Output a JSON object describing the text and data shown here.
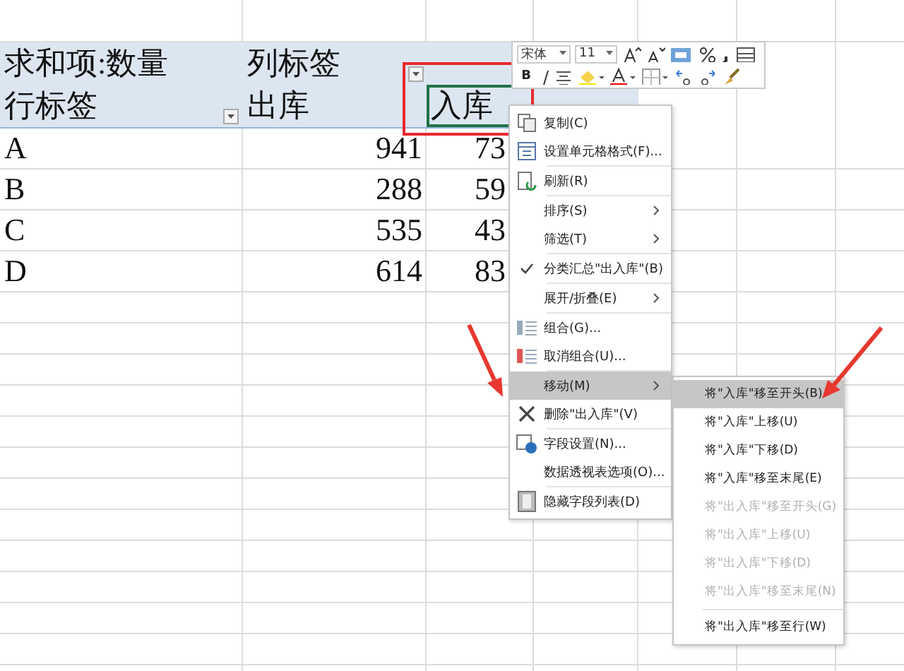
{
  "pivot": {
    "value_header": "求和项:数量",
    "column_header": "列标签",
    "row_header": "行标签",
    "columns": [
      {
        "label": "出库",
        "selected": false
      },
      {
        "label": "入库",
        "selected": true
      }
    ],
    "rows": [
      {
        "label": "A",
        "values": [
          "941",
          "73"
        ]
      },
      {
        "label": "B",
        "values": [
          "288",
          "59"
        ]
      },
      {
        "label": "C",
        "values": [
          "535",
          "43"
        ]
      },
      {
        "label": "D",
        "values": [
          "614",
          "83"
        ]
      }
    ]
  },
  "mini_toolbar": {
    "font": "宋体",
    "size": "11",
    "bold": "B"
  },
  "context_menu": [
    {
      "kind": "item",
      "label": "复制(C)",
      "submenu": false,
      "checked": false,
      "selected": false
    },
    {
      "kind": "item",
      "label": "设置单元格格式(F)...",
      "submenu": false,
      "checked": false,
      "selected": false
    },
    {
      "kind": "separator"
    },
    {
      "kind": "item",
      "label": "刷新(R)",
      "submenu": false,
      "checked": false,
      "selected": false
    },
    {
      "kind": "separator"
    },
    {
      "kind": "item",
      "label": "排序(S)",
      "submenu": true,
      "checked": false,
      "selected": false
    },
    {
      "kind": "item",
      "label": "筛选(T)",
      "submenu": true,
      "checked": false,
      "selected": false
    },
    {
      "kind": "separator"
    },
    {
      "kind": "item",
      "label": "分类汇总\"出入库\"(B)",
      "submenu": false,
      "checked": true,
      "selected": false
    },
    {
      "kind": "separator"
    },
    {
      "kind": "item",
      "label": "展开/折叠(E)",
      "submenu": true,
      "checked": false,
      "selected": false
    },
    {
      "kind": "separator"
    },
    {
      "kind": "item",
      "label": "组合(G)...",
      "submenu": false,
      "checked": false,
      "selected": false
    },
    {
      "kind": "item",
      "label": "取消组合(U)...",
      "submenu": false,
      "checked": false,
      "selected": false
    },
    {
      "kind": "separator"
    },
    {
      "kind": "item",
      "label": "移动(M)",
      "submenu": true,
      "checked": false,
      "selected": true
    },
    {
      "kind": "item",
      "label": "删除\"出入库\"(V)",
      "submenu": false,
      "checked": false,
      "selected": false
    },
    {
      "kind": "separator"
    },
    {
      "kind": "item",
      "label": "字段设置(N)...",
      "submenu": false,
      "checked": false,
      "selected": false
    },
    {
      "kind": "item",
      "label": "数据透视表选项(O)...",
      "submenu": false,
      "checked": false,
      "selected": false
    },
    {
      "kind": "separator"
    },
    {
      "kind": "item",
      "label": "隐藏字段列表(D)",
      "submenu": false,
      "checked": false,
      "selected": false
    }
  ],
  "submenu": [
    {
      "kind": "item",
      "label": "将\"入库\"移至开头(B)",
      "disabled": false,
      "selected": true
    },
    {
      "kind": "item",
      "label": "将\"入库\"上移(U)",
      "disabled": false,
      "selected": false
    },
    {
      "kind": "item",
      "label": "将\"入库\"下移(D)",
      "disabled": false,
      "selected": false
    },
    {
      "kind": "item",
      "label": "将\"入库\"移至末尾(E)",
      "disabled": false,
      "selected": false
    },
    {
      "kind": "item",
      "label": "将\"出入库\"移至开头(G)",
      "disabled": true,
      "selected": false
    },
    {
      "kind": "item",
      "label": "将\"出入库\"上移(U)",
      "disabled": true,
      "selected": false
    },
    {
      "kind": "item",
      "label": "将\"出入库\"下移(D)",
      "disabled": true,
      "selected": false
    },
    {
      "kind": "item",
      "label": "将\"出入库\"移至末尾(N)",
      "disabled": true,
      "selected": false
    },
    {
      "kind": "separator"
    },
    {
      "kind": "item",
      "label": "将\"出入库\"移至行(W)",
      "disabled": false,
      "selected": false
    }
  ]
}
